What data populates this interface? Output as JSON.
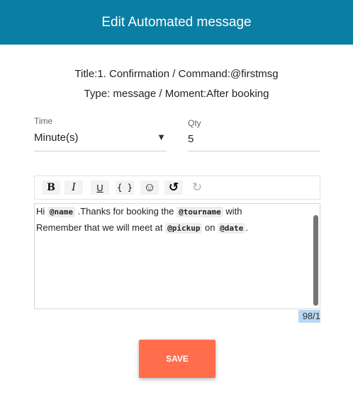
{
  "header": {
    "title": "Edit Automated message"
  },
  "info": {
    "line1": "Title:1. Confirmation / Command:@firstmsg",
    "line2": "Type: message / Moment:After booking"
  },
  "time_field": {
    "label": "Time",
    "value": "Minute(s)"
  },
  "qty_field": {
    "label": "Qty",
    "value": "5"
  },
  "toolbar": {
    "bold": "B",
    "italic": "I",
    "underline": "U",
    "code": "{ }",
    "emoji": "☺",
    "undo": "↺",
    "redo": "↻"
  },
  "editor": {
    "line1": {
      "t1": "Hi ",
      "tag1": "@name",
      "t2": " .Thanks for booking the ",
      "tag2": "@tourname",
      "t3": " with"
    },
    "line2": {
      "t1": "Remember that we will  meet at ",
      "tag1": "@pickup",
      "t2": " on ",
      "tag2": "@date",
      "t3": "."
    }
  },
  "counter": "98/1",
  "save_label": "SAVE",
  "colors": {
    "header": "#0b7ea3",
    "save": "#ff6d4d",
    "counter_highlight": "#b8d7f3"
  }
}
